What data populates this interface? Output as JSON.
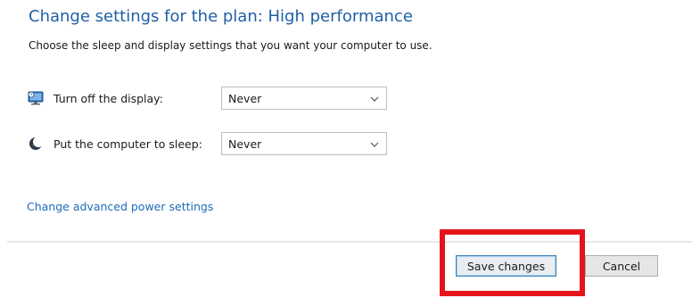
{
  "header": {
    "title": "Change settings for the plan: High performance",
    "subtitle": "Choose the sleep and display settings that you want your computer to use."
  },
  "settings": {
    "display": {
      "icon": "monitor-icon",
      "label": "Turn off the display:",
      "value": "Never"
    },
    "sleep": {
      "icon": "sleep-moon-icon",
      "label": "Put the computer to sleep:",
      "value": "Never"
    }
  },
  "links": {
    "advanced": "Change advanced power settings"
  },
  "footer": {
    "save_label": "Save changes",
    "cancel_label": "Cancel"
  },
  "annotation": {
    "highlight_color": "#e5141b"
  },
  "colors": {
    "title": "#1f5fa6",
    "link": "#1f6bb8"
  }
}
